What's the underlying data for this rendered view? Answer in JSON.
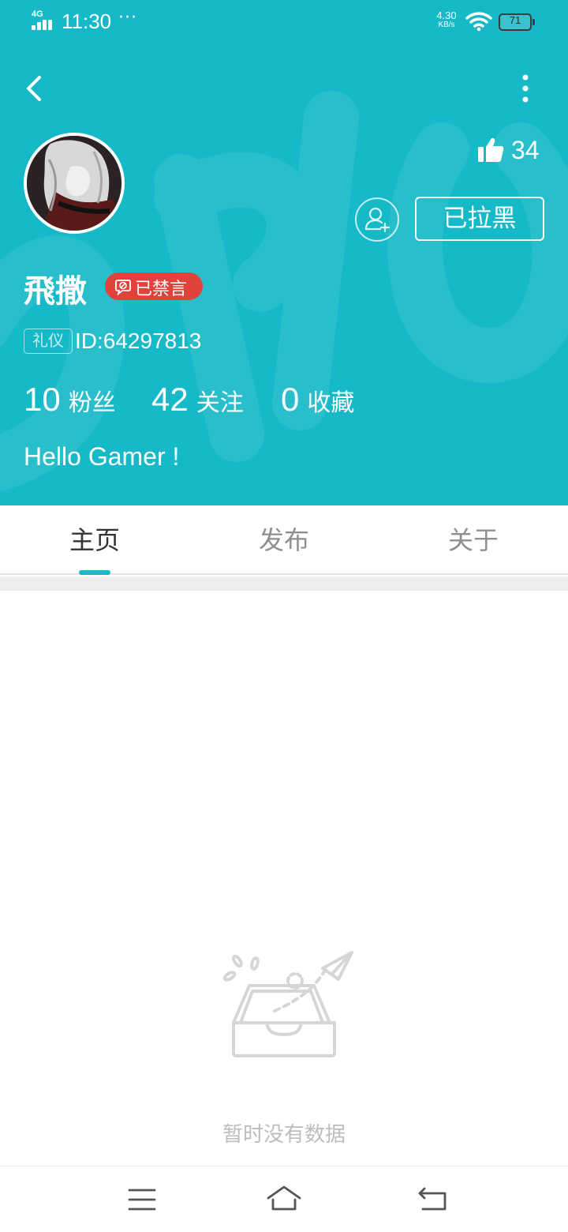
{
  "status_bar": {
    "network": "4G",
    "time": "11:30",
    "more": "···",
    "speed_value": "4.30",
    "speed_unit": "KB/s",
    "battery": "71"
  },
  "header": {
    "background_color": "#16b9c7",
    "back_icon": "chevron-left-icon",
    "more_icon": "more-vertical-icon",
    "likes_count": "34",
    "username": "飛撒",
    "muted_badge": "已禁言",
    "muted_badge_color": "#e0433b",
    "etiquette_tag": "礼仪",
    "user_id": "ID:64297813",
    "follow_icon": "add-user-icon",
    "blocked_button": "已拉黑",
    "stats": {
      "fans_value": "10",
      "fans_label": "粉丝",
      "following_value": "42",
      "following_label": "关注",
      "favorites_value": "0",
      "favorites_label": "收藏"
    },
    "bio": "Hello Gamer !"
  },
  "tabs": [
    {
      "label": "主页",
      "active": true
    },
    {
      "label": "发布",
      "active": false
    },
    {
      "label": "关于",
      "active": false
    }
  ],
  "empty_state": {
    "icon": "empty-inbox-icon",
    "text": "暂时没有数据"
  },
  "nav_bar": {
    "menu_icon": "menu-icon",
    "home_icon": "home-icon",
    "back_icon": "back-icon"
  }
}
